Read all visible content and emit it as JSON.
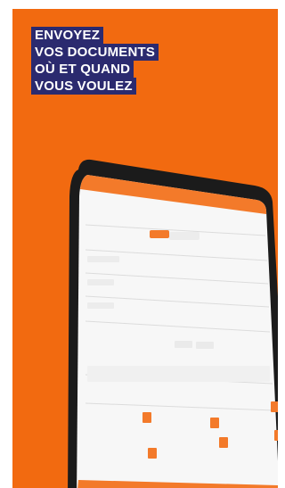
{
  "headline": {
    "lines": [
      "ENVOYEZ",
      "VOS DOCUMENTS",
      "OÙ ET QUAND",
      "VOUS VOULEZ"
    ]
  },
  "colors": {
    "background": "#f26a10",
    "headline_band": "#2b2a6f",
    "tablet_bezel": "#1b1b1b",
    "app_accent": "#f37a2a"
  },
  "icons": [
    "tablet-device",
    "document-icon",
    "camera-icon",
    "folder-icon"
  ]
}
